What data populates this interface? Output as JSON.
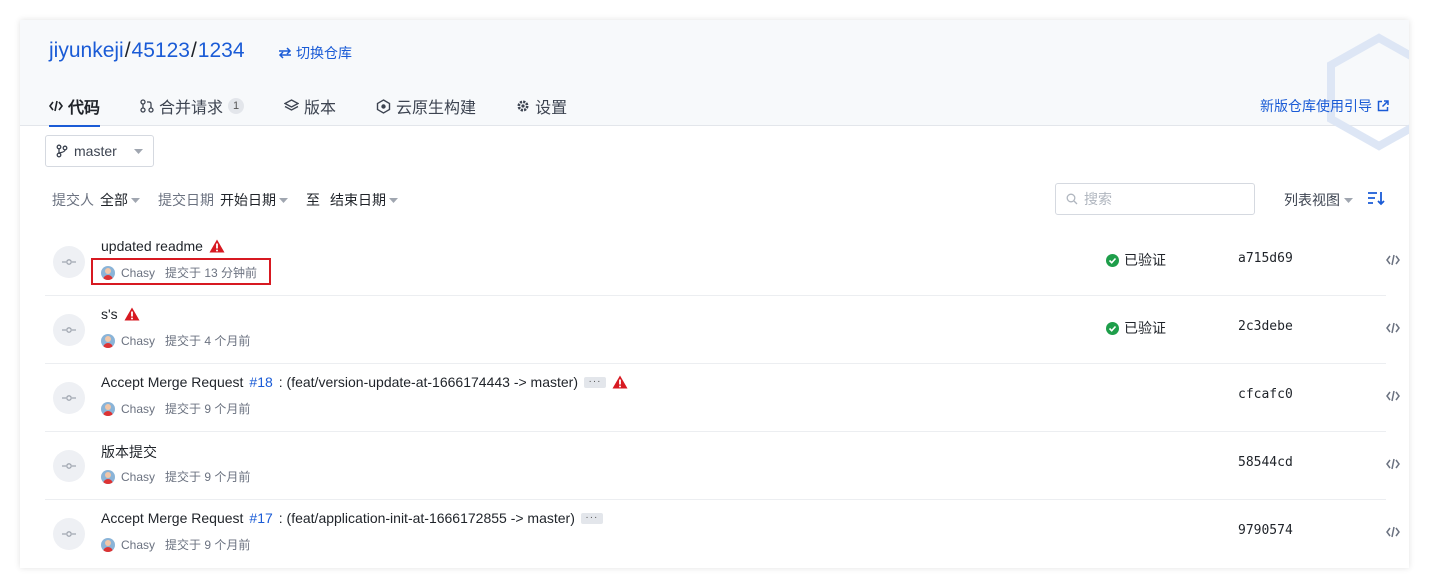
{
  "repo": {
    "owner": "jiyunkeji",
    "group": "45123",
    "name": "1234",
    "sep": "/",
    "switch_label": "切换仓库"
  },
  "tabs": [
    {
      "label": "代码",
      "icon": "code-icon",
      "active": true
    },
    {
      "label": "合并请求",
      "icon": "merge-request-icon",
      "count": "1"
    },
    {
      "label": "版本",
      "icon": "layers-icon"
    },
    {
      "label": "云原生构建",
      "icon": "cloud-build-icon"
    },
    {
      "label": "设置",
      "icon": "gear-icon"
    }
  ],
  "guide_link": "新版仓库使用引导",
  "branch": {
    "value": "master"
  },
  "filters": {
    "committer_label": "提交人",
    "committer_value": "全部",
    "date_label": "提交日期",
    "start_date": "开始日期",
    "to_label": "至",
    "end_date": "结束日期"
  },
  "search": {
    "placeholder": "搜索"
  },
  "view": {
    "label": "列表视图"
  },
  "commits": [
    {
      "message": "updated readme",
      "author": "Chasy",
      "time": "提交于 13 分钟前",
      "verified": "已验证",
      "sha": "a715d69",
      "warning": true
    },
    {
      "message": "s's",
      "author": "Chasy",
      "time": "提交于 4 个月前",
      "verified": "已验证",
      "sha": "2c3debe",
      "warning": true
    },
    {
      "message_prefix": "Accept Merge Request",
      "mr": "#18",
      "message_suffix": ": (feat/version-update-at-1666174443 -> master)",
      "author": "Chasy",
      "time": "提交于 9 个月前",
      "sha": "cfcafc0",
      "warning": true
    },
    {
      "message": "版本提交",
      "author": "Chasy",
      "time": "提交于 9 个月前",
      "sha": "58544cd"
    },
    {
      "message_prefix": "Accept Merge Request",
      "mr": "#17",
      "message_suffix": ": (feat/application-init-at-1666172855 -> master)",
      "author": "Chasy",
      "time": "提交于 9 个月前",
      "sha": "9790574"
    }
  ],
  "colors": {
    "accent": "#1a5bd6",
    "warning": "#d71921",
    "verified": "#1e9e4a",
    "highlight_border": "#d71921"
  }
}
